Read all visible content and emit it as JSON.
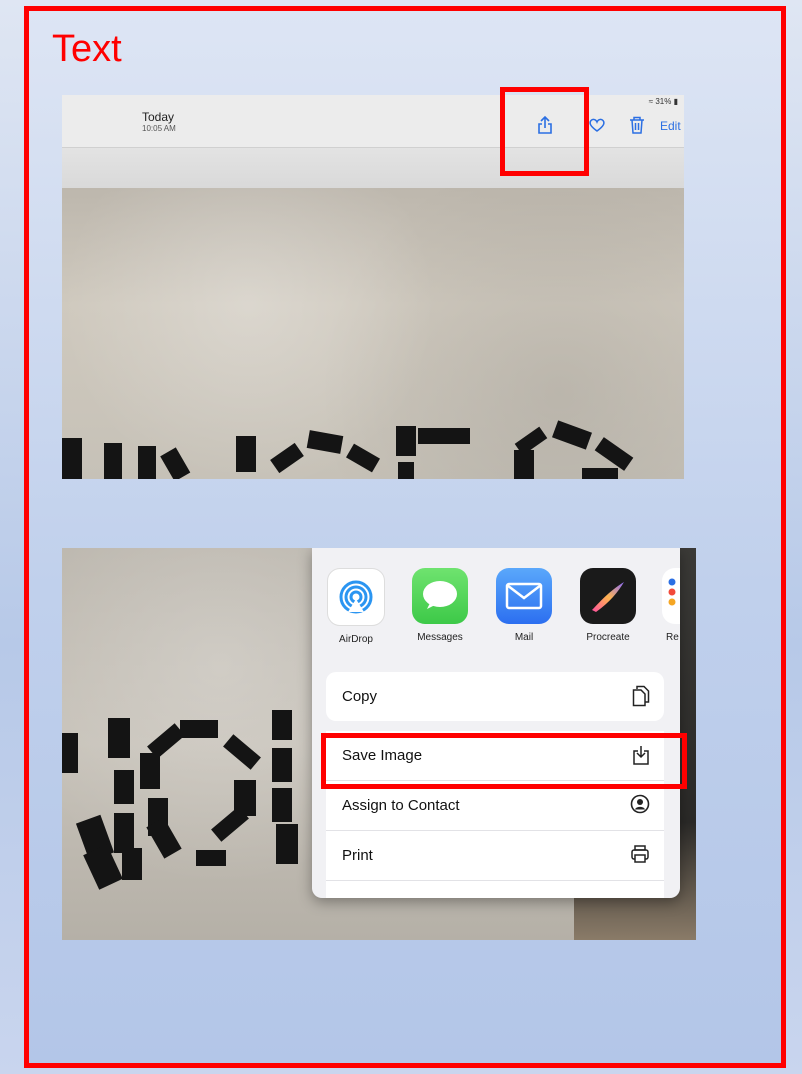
{
  "slide": {
    "title": "Text"
  },
  "photos_screen": {
    "date": "Today",
    "time": "10:05 AM",
    "status": "31%",
    "edit_label": "Edit",
    "icons": [
      "share-icon",
      "heart-icon",
      "trash-icon"
    ]
  },
  "share_sheet": {
    "apps": [
      {
        "label": "AirDrop",
        "icon": "airdrop-icon"
      },
      {
        "label": "Messages",
        "icon": "messages-icon"
      },
      {
        "label": "Mail",
        "icon": "mail-icon"
      },
      {
        "label": "Procreate",
        "icon": "procreate-icon"
      },
      {
        "label": "Re",
        "icon": "reminders-icon"
      }
    ],
    "copy_label": "Copy",
    "actions": [
      {
        "label": "Save Image",
        "icon": "save-image-icon"
      },
      {
        "label": "Assign to Contact",
        "icon": "contact-icon"
      },
      {
        "label": "Print",
        "icon": "print-icon"
      }
    ]
  },
  "colors": {
    "highlight": "#ff0000",
    "ios_blue": "#2b6fe3",
    "messages_green": "#4cd964",
    "mail_blue": "#3f8ef5"
  }
}
